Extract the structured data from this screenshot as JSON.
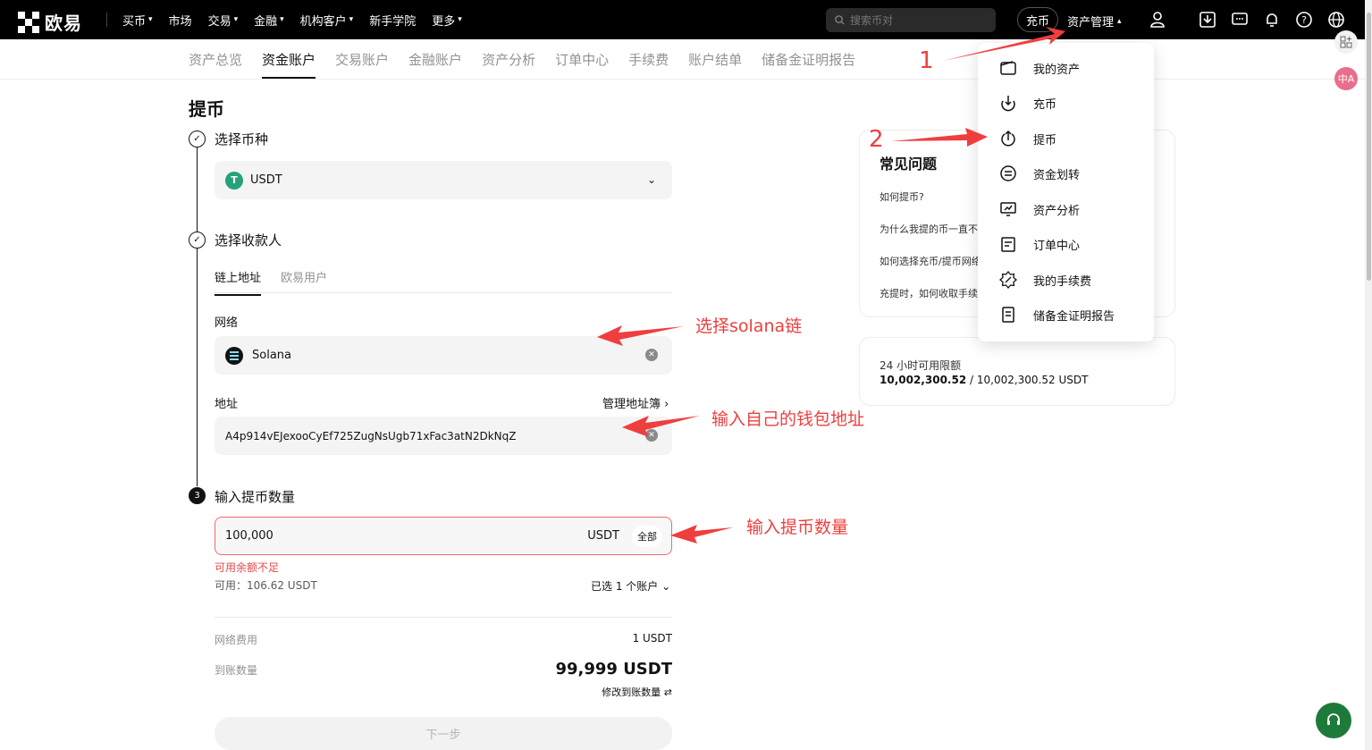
{
  "topbar": {
    "logo_text": "欧易",
    "nav": [
      "买币",
      "市场",
      "交易",
      "金融",
      "机构客户",
      "新手学院",
      "更多"
    ],
    "search_placeholder": "搜索币对",
    "deposit_label": "充币",
    "asset_mgmt_label": "资产管理"
  },
  "subnav": [
    "资产总览",
    "资金账户",
    "交易账户",
    "金融账户",
    "资产分析",
    "订单中心",
    "手续费",
    "账户结单",
    "储备金证明报告"
  ],
  "page_title": "提币",
  "step1": {
    "title": "选择币种",
    "coin": "USDT",
    "coin_symbol": "T"
  },
  "step2": {
    "title": "选择收款人",
    "tabs": [
      "链上地址",
      "欧易用户"
    ],
    "network_label": "网络",
    "network_value": "Solana",
    "address_label": "地址",
    "address_book": "管理地址簿",
    "address_value": "A4p914vEJexooCyEf725ZugNsUgb71xFac3atN2DkNqZ"
  },
  "step3": {
    "number": "3",
    "title": "输入提币数量",
    "amount_value": "100,000",
    "amount_unit": "USDT",
    "all_label": "全部",
    "error": "可用余额不足",
    "available": "可用：106.62 USDT",
    "accounts": "已选 1 个账户",
    "fee_label": "网络费用",
    "fee_value": "1 USDT",
    "receive_label": "到账数量",
    "receive_value": "99,999 USDT",
    "modify_label": "修改到账数量",
    "next_label": "下一步"
  },
  "faq": {
    "title": "常见问题",
    "items": [
      "如何提币?",
      "为什么我提的币一直不到账",
      "如何选择充币/提币网络",
      "充提时，如何收取手续费"
    ]
  },
  "limit": {
    "title": "24 小时可用限额",
    "used": "10,002,300.52",
    "total": "/ 10,002,300.52 USDT"
  },
  "dropdown": [
    "我的资产",
    "充币",
    "提币",
    "资金划转",
    "资产分析",
    "订单中心",
    "我的手续费",
    "储备金证明报告"
  ],
  "side_tools": {
    "translate_label": "中A"
  },
  "annotations": {
    "num1": "1",
    "num2": "2",
    "solana": "选择solana链",
    "address": "输入自己的钱包地址",
    "amount": "输入提币数量"
  },
  "colors": {
    "annotation": "#ef3e3e",
    "error": "#e5484d",
    "support": "#1e7a3a"
  }
}
